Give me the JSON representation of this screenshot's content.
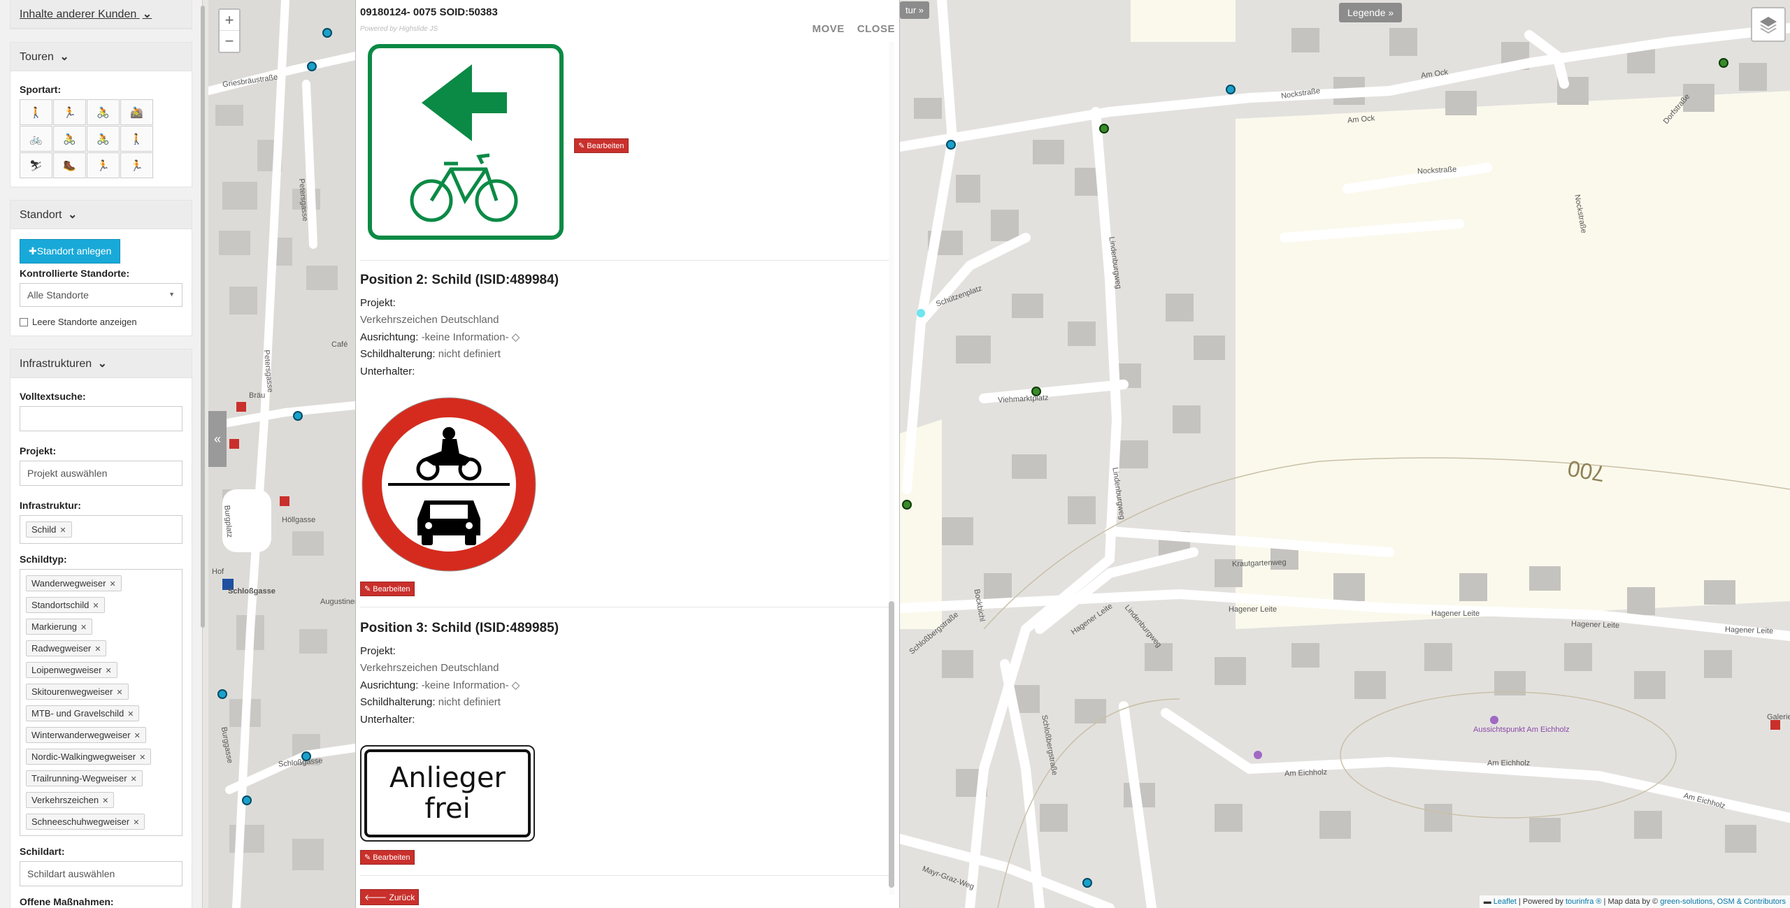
{
  "sidebar": {
    "kunden_label": "Inhalte anderer Kunden",
    "touren": {
      "header": "Touren",
      "sportart_label": "Sportart:"
    },
    "standort": {
      "header": "Standort",
      "create_button": "Standort anlegen",
      "kontrollierte_label": "Kontrollierte Standorte:",
      "select_value": "Alle Standorte",
      "leere_label": "Leere Standorte anzeigen"
    },
    "infra": {
      "header": "Infrastrukturen",
      "volltext_label": "Volltextsuche:",
      "projekt_label": "Projekt:",
      "projekt_placeholder": "Projekt auswählen",
      "infrastruktur_label": "Infrastruktur:",
      "infrastruktur_tags": [
        "Schild"
      ],
      "schildtyp_label": "Schildtyp:",
      "schildtyp_tags": [
        "Wanderwegweiser",
        "Standortschild",
        "Markierung",
        "Radwegweiser",
        "Loipenwegweiser",
        "Skitourenwegweiser",
        "MTB- und Gravelschild",
        "Winterwanderwegweiser",
        "Nordic-Walkingwegweiser",
        "Trailrunning-Wegweiser",
        "Verkehrszeichen",
        "Schneeschuhwegweiser"
      ],
      "schildart_label": "Schildart:",
      "schildart_placeholder": "Schildart auswählen",
      "offene_label": "Offene Maßnahmen:"
    }
  },
  "popup": {
    "title": "09180124- 0075 SOID:50383",
    "powered": "Powered by Highslide JS",
    "move": "MOVE",
    "close": "CLOSE",
    "edit_label": "Bearbeiten",
    "back_label": "Zurück",
    "positions": [
      {
        "heading": "Position 2: Schild (ISID:489984)",
        "projekt_label": "Projekt:",
        "projekt_value": "Verkehrszeichen Deutschland",
        "ausrichtung_label": "Ausrichtung:",
        "ausrichtung_value": "-keine Information-",
        "halterung_label": "Schildhalterung:",
        "halterung_value": "nicht definiert",
        "unterhalter_label": "Unterhalter:"
      },
      {
        "heading": "Position 3: Schild (ISID:489985)",
        "projekt_label": "Projekt:",
        "projekt_value": "Verkehrszeichen Deutschland",
        "ausrichtung_label": "Ausrichtung:",
        "ausrichtung_value": "-keine Information-",
        "halterung_label": "Schildhalterung:",
        "halterung_value": "nicht definiert",
        "unterhalter_label": "Unterhalter:"
      }
    ],
    "sign3_line1": "Anlieger",
    "sign3_line2": "frei"
  },
  "map": {
    "zoom_in": "+",
    "zoom_out": "−",
    "collapse": "«",
    "legend": "Legende",
    "topleft_btn": "tur",
    "contour": "700",
    "attribution_leaflet": "Leaflet",
    "attribution_powered": "| Powered by",
    "attribution_tourinfra": "tourinfra ®",
    "attribution_mapdata": "| Map data by ©",
    "attribution_green": "green-solutions",
    "attribution_osm": "OSM & Contributors",
    "streets_left": [
      "Griesbräustraße",
      "Petersgasse",
      "Petersgasse",
      "Höllgasse",
      "Burggasse",
      "Schloßgasse",
      "Augustinerplatz",
      "Hof",
      "Burgplatz",
      "Schloßgasse",
      "Café",
      "Bräu"
    ],
    "streets_right": [
      "Nockstraße",
      "Am Ock",
      "Am Ock",
      "Nockstraße",
      "Dorfstraße",
      "Nockstraße",
      "Schützenplatz",
      "Lindenburgweg",
      "Viehmarktplatz",
      "Lindenburgweg",
      "Krautgartenweg",
      "Hagener Leite",
      "Hagener Leite",
      "Hagener Leite",
      "Hagener Leite",
      "Hagener Leite",
      "Lindenburgweg",
      "Schloßbergstraße",
      "Schloßbergstraße",
      "Bockbichl",
      "Am Eichholz",
      "Am Eichholz",
      "Am Eichholz",
      "Mayr-Graz-Weg",
      "Aussichtspunkt Am Eichholz",
      "Galerie & Atelier"
    ]
  },
  "colors": {
    "accent_blue": "#19a9d9",
    "edit_red": "#c9302c",
    "sign_green": "#0b8a45",
    "sign_red": "#d52b1e"
  }
}
